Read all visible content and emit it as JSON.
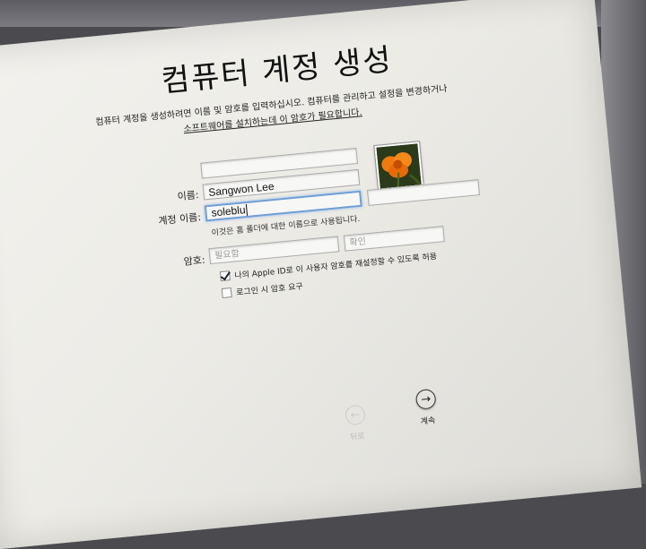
{
  "window": {
    "title": "컴퓨터 계정 생성",
    "description_line1": "컴퓨터 계정을 생성하려면 이름 및 암호를 입력하십시오. 컴퓨터를 관리하고 설정을 변경하거나",
    "description_line2": "소프트웨어를 설치하는데 이 암호가 필요합니다."
  },
  "form": {
    "name_label": "이름:",
    "name_value": "Sangwon Lee",
    "account_label": "계정 이름:",
    "account_value": "soleblu",
    "account_hint": "이것은 홈 폴더에 대한 이름으로 사용됩니다.",
    "password_label": "암호:",
    "password_placeholder": "필요함",
    "verify_placeholder": "확인",
    "apple_id_reset_label": "나의 Apple ID로 이 사용자 암호를 재설정할 수 있도록 허용",
    "apple_id_reset_checked": true,
    "require_password_label": "로그인 시 암호 요구",
    "require_password_checked": false
  },
  "avatar": {
    "icon": "orange-poppy-flower"
  },
  "navigation": {
    "back_label": "뒤로",
    "continue_label": "계속",
    "back_icon": "left-arrow-icon",
    "continue_icon": "right-arrow-icon"
  },
  "colors": {
    "focus_ring": "#6f9ed6",
    "background": "#ecebe6"
  }
}
